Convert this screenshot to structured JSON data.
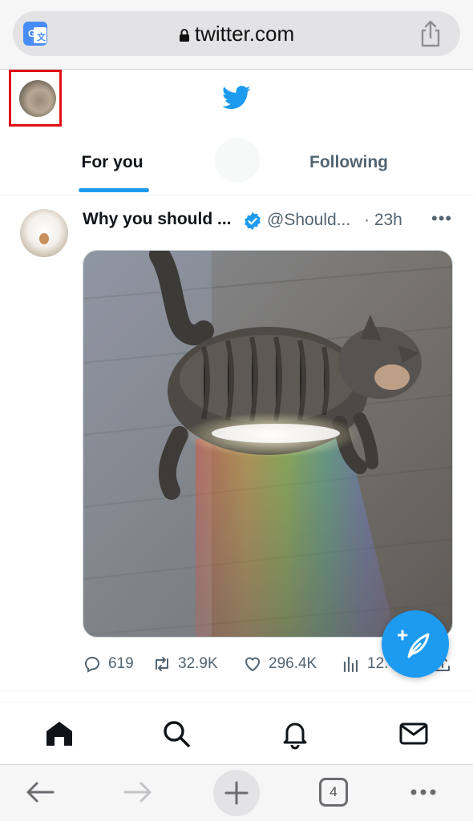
{
  "browser": {
    "url": "twitter.com",
    "tab_count": "4"
  },
  "header": {
    "logo": "twitter-bird-icon"
  },
  "tabs": [
    {
      "label": "For you",
      "active": true
    },
    {
      "label": "Following",
      "active": false
    }
  ],
  "tweet": {
    "author_name": "Why you should ...",
    "handle": "@Should...",
    "time": "· 23h",
    "more": "•••",
    "media_description_icon": "cat-rainbow-photo",
    "stats": {
      "replies": "619",
      "retweets": "32.9K",
      "likes": "296.4K",
      "views": "12.4"
    }
  },
  "bottom_nav": [
    "home-icon",
    "search-icon",
    "notifications-icon",
    "messages-icon"
  ],
  "colors": {
    "accent": "#1d9bf0",
    "text": "#0f1419",
    "muted": "#536471",
    "highlight": "#e01010"
  }
}
